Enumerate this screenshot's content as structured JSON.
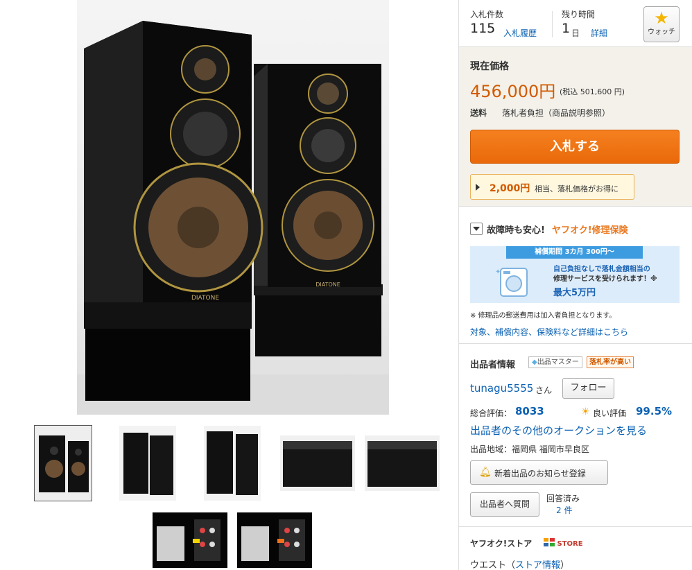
{
  "gallery": {
    "brand_label": "DIATONE",
    "thumbnails": [
      "thumb-1",
      "thumb-2",
      "thumb-3",
      "thumb-4",
      "thumb-5",
      "thumb-6",
      "thumb-7"
    ],
    "selected_index": 0
  },
  "bids": {
    "label": "入札件数",
    "count": "115",
    "history_link": "入札履歴"
  },
  "time_left": {
    "label": "残り時間",
    "value": "1",
    "unit": "日",
    "detail_link": "詳細"
  },
  "watch": {
    "label": "ウォッチ",
    "icon": "star-icon"
  },
  "price": {
    "label": "現在価格",
    "value": "456,000円",
    "tax_note": "(税込 501,600 円)",
    "shipping_label": "送料",
    "shipping_value": "落札者負担（商品説明参照）",
    "bid_button": "入札する",
    "promo_amount": "2,000円",
    "promo_text": "相当、落札価格がお得に"
  },
  "insurance": {
    "title": "故障時も安心!",
    "brand": "ヤフオク!修理保険",
    "banner_tab": "補償期間 3カ月 300円〜",
    "banner_line1": "自己負担なしで落札金額相当の",
    "banner_line2": "修理サービスを受けられます！※",
    "banner_line3": "最大5万円",
    "note": "※ 修理品の郵送費用は加入者負担となります。",
    "detail_link": "対象、補償内容、保険料など詳細はこちら"
  },
  "seller": {
    "title": "出品者情報",
    "badge_master": "出品マスター",
    "badge_rate": "落札率が高い",
    "name": "tunagu5555",
    "honorific": "さん",
    "follow_button": "フォロー",
    "total_rating_label": "総合評価：",
    "total_rating": "8033",
    "good_label": "良い評価",
    "good_rate": "99.5%",
    "other_auctions_link": "出品者のその他のオークションを見る",
    "region": "出品地域：福岡県 福岡市早良区",
    "notify_button": "新着出品のお知らせ登録",
    "ask_button": "出品者へ質問",
    "answered_label": "回答済み",
    "answered_count": "2 件"
  },
  "store": {
    "title": "ヤフオク!ストア",
    "badge": "STORE",
    "name_prefix": "ウエスト（",
    "info_link": "ストア情報",
    "name_suffix": "）"
  },
  "colors": {
    "accent": "#e8771d",
    "price": "#d25a00",
    "link": "#0b61b3",
    "panel": "#f3f1ea"
  }
}
